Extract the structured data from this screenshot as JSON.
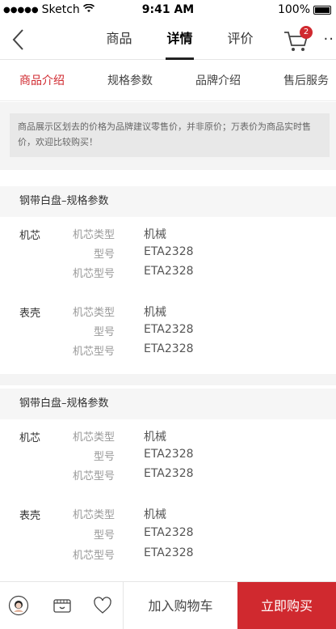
{
  "status_bar": {
    "signal_dots": "●●●●●",
    "carrier": "Sketch",
    "time": "9:41 AM",
    "battery": "100%"
  },
  "nav": {
    "tabs": [
      {
        "label": "商品"
      },
      {
        "label": "详情"
      },
      {
        "label": "评价"
      }
    ],
    "active_tab": "详情",
    "cart_badge": "2",
    "more": "··"
  },
  "sub_tabs": [
    {
      "label": "商品介绍"
    },
    {
      "label": "规格参数"
    },
    {
      "label": "品牌介绍"
    },
    {
      "label": "售后服务"
    }
  ],
  "notice": {
    "text": "商品展示区划去的价格为品牌建议零售价，并非原价；万表价为商品实时售价，欢迎比较购买！"
  },
  "sections": [
    {
      "title": "钢带白盘–规格参数",
      "groups": [
        {
          "label": "机芯",
          "rows": [
            {
              "k": "机芯类型",
              "v": "机械"
            },
            {
              "k": "型号",
              "v": "ETA2328"
            },
            {
              "k": "机芯型号",
              "v": "ETA2328"
            }
          ]
        },
        {
          "label": "表壳",
          "rows": [
            {
              "k": "机芯类型",
              "v": "机械"
            },
            {
              "k": "型号",
              "v": "ETA2328"
            },
            {
              "k": "机芯型号",
              "v": "ETA2328"
            }
          ]
        }
      ]
    },
    {
      "title": "钢带白盘–规格参数",
      "groups": [
        {
          "label": "机芯",
          "rows": [
            {
              "k": "机芯类型",
              "v": "机械"
            },
            {
              "k": "型号",
              "v": "ETA2328"
            },
            {
              "k": "机芯型号",
              "v": "ETA2328"
            }
          ]
        },
        {
          "label": "表壳",
          "rows": [
            {
              "k": "机芯类型",
              "v": "机械"
            },
            {
              "k": "型号",
              "v": "ETA2328"
            },
            {
              "k": "机芯型号",
              "v": "ETA2328"
            }
          ]
        }
      ]
    }
  ],
  "bottom_bar": {
    "add_to_cart": "加入购物车",
    "buy_now": "立即购买",
    "icons": [
      "customer-service-icon",
      "shop-icon",
      "heart-icon"
    ]
  },
  "colors": {
    "accent": "#d0292f",
    "bg_gray": "#f4f4f4"
  }
}
